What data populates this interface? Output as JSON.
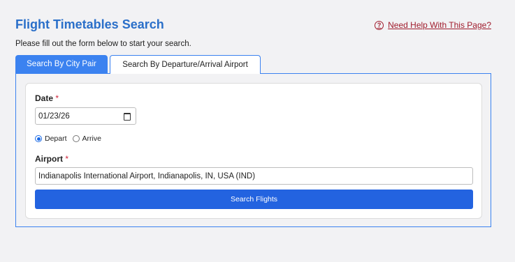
{
  "header": {
    "title": "Flight Timetables Search",
    "help_link": "Need Help With This Page?",
    "help_icon": "question-circle-icon",
    "help_color": "#a01c2c",
    "instructions": "Please fill out the form below to start your search."
  },
  "tabs": [
    {
      "label": "Search By City Pair",
      "active": false
    },
    {
      "label": "Search By Departure/Arrival Airport",
      "active": true
    }
  ],
  "form": {
    "date_label": "Date",
    "required_marker": "*",
    "date_value": "01/23/26",
    "date_icon": "calendar-icon",
    "radio_options": [
      {
        "label": "Depart",
        "checked": true
      },
      {
        "label": "Arrive",
        "checked": false
      }
    ],
    "airport_label": "Airport",
    "airport_value": "Indianapolis International Airport, Indianapolis, IN, USA (IND)",
    "search_button": "Search Flights"
  },
  "colors": {
    "accent": "#3b82f0",
    "button": "#2363e0",
    "title": "#2a6fc9",
    "required": "#d0243a"
  }
}
